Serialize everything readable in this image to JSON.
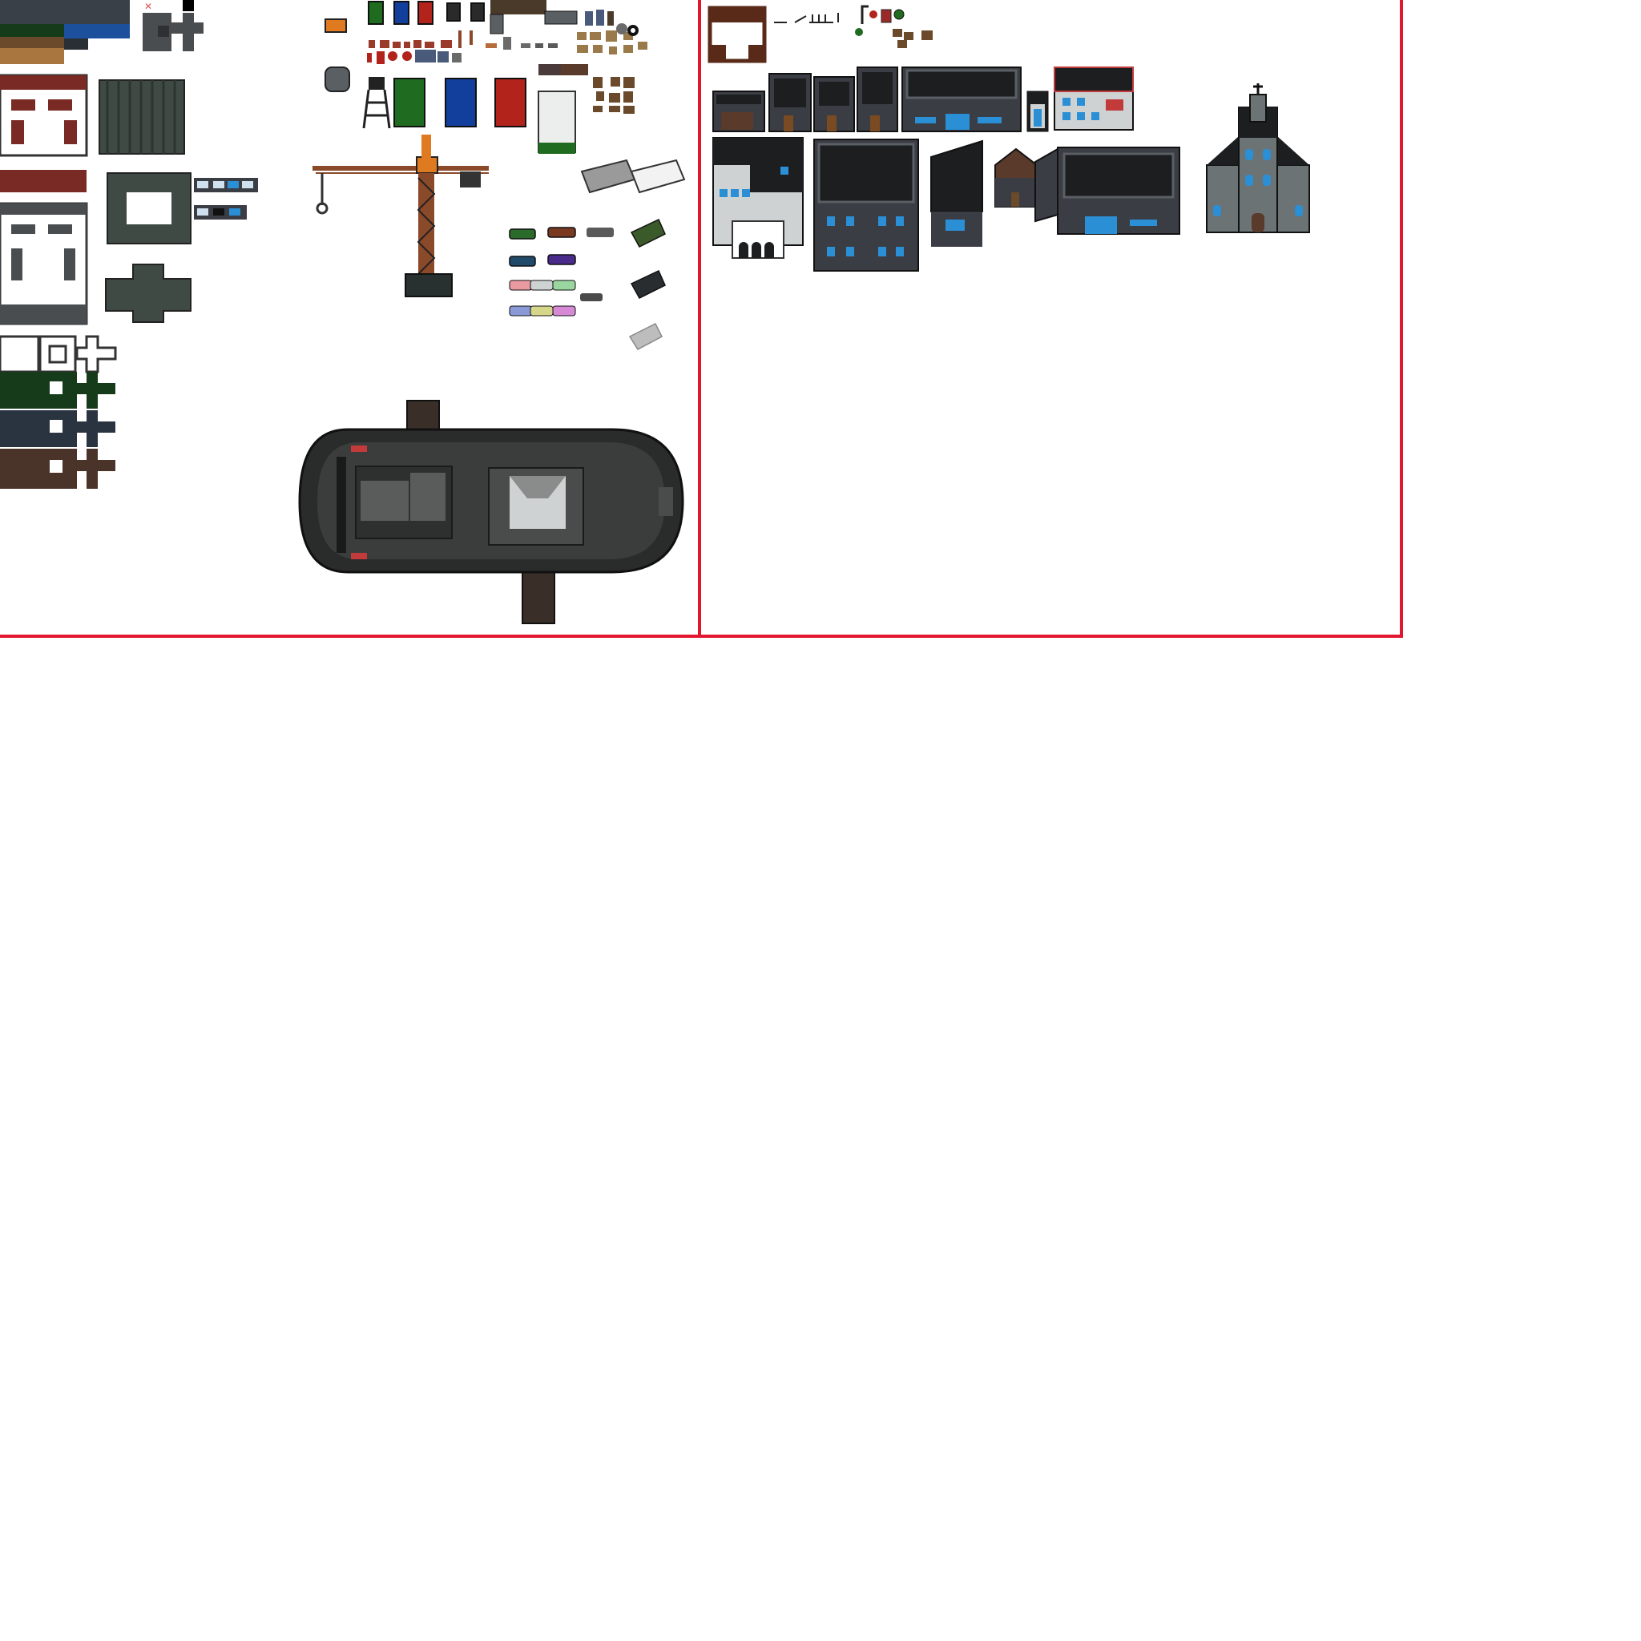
{
  "sheet": {
    "background": "#ffffff",
    "divider_color": "#e2162f",
    "panels": [
      "tiles-and-props",
      "buildings"
    ]
  },
  "palette": {
    "roof_dark": "#1c1e20",
    "wall_dark": "#3b3d45",
    "wall_gray": "#5a5f63",
    "brick": "#7a2a24",
    "window_blue": "#2b8fd6",
    "grass": "#163b1a",
    "water": "#1c4f9c",
    "dirt": "#8a5a32",
    "crane_orange": "#e07a20",
    "container_green": "#1f6b20",
    "container_blue": "#123f9b",
    "container_red": "#b1231b",
    "church_stone": "#6b7375",
    "boat_hull": "#2a2b2b",
    "boat_deck": "#3b3d3d"
  },
  "icons": [
    "crane",
    "tugboat",
    "church",
    "warehouse",
    "shipping-container",
    "car",
    "truck",
    "water-tower",
    "fence",
    "street-lamp",
    "tree"
  ]
}
